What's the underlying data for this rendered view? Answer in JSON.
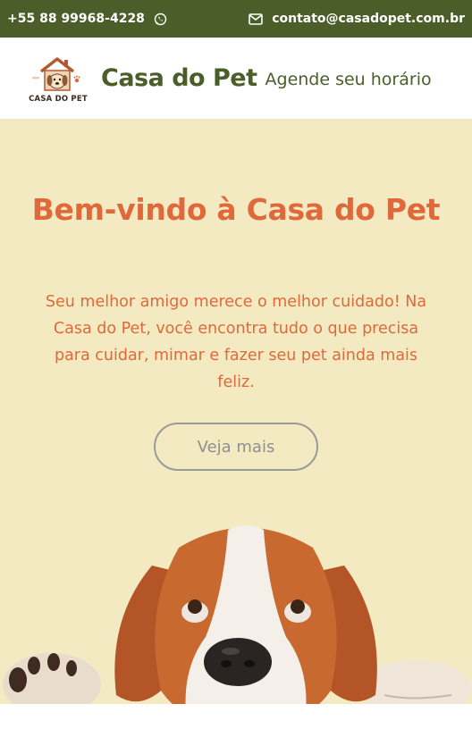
{
  "topbar": {
    "phone": "+55 88 99968-4228",
    "email": "contato@casadopet.com.br",
    "icons": {
      "phone": "whatsapp-icon",
      "email": "envelope-icon"
    }
  },
  "header": {
    "logo_text": "CASA DO PET",
    "brand": "Casa do Pet",
    "tagline": "Agende seu horário"
  },
  "hero": {
    "title": "Bem-vindo à Casa do Pet",
    "text": "Seu melhor amigo merece o melhor cuidado! Na Casa do Pet, você encontra tudo o que precisa para cuidar, mimar e fazer seu pet ainda mais feliz.",
    "button": "Veja mais"
  },
  "colors": {
    "topbar_bg": "#4b5e2a",
    "hero_bg": "#f3eac2",
    "accent": "#e0693c",
    "brand": "#4b5e2a"
  }
}
